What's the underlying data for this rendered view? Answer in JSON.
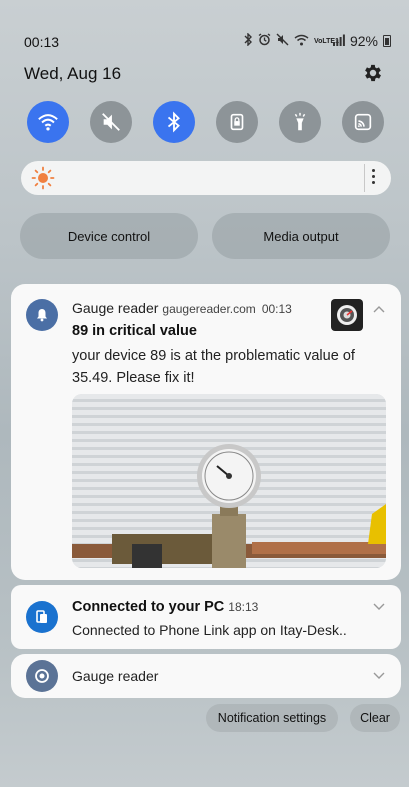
{
  "status_bar": {
    "time": "00:13",
    "network_label": "VoLTE1",
    "battery": "92%",
    "icons": [
      "bluetooth-icon",
      "alarm-icon",
      "mute-icon",
      "wifi-icon",
      "signal-icon",
      "battery-icon"
    ]
  },
  "header": {
    "date": "Wed, Aug 16"
  },
  "quick_toggles": [
    {
      "name": "wifi",
      "icon": "wifi-icon",
      "on": true
    },
    {
      "name": "sound",
      "icon": "mute-icon",
      "on": false
    },
    {
      "name": "bluetooth",
      "icon": "bluetooth-icon",
      "on": true
    },
    {
      "name": "rotation-lock",
      "icon": "lock-icon",
      "on": false
    },
    {
      "name": "flashlight",
      "icon": "flashlight-icon",
      "on": false
    },
    {
      "name": "cast",
      "icon": "cast-icon",
      "on": false
    }
  ],
  "colors": {
    "accent": "#3a74ef",
    "toggle_off": "#8d9498",
    "sun": "#f08040"
  },
  "controls": {
    "device_control": "Device control",
    "media_output": "Media output"
  },
  "notifications": [
    {
      "app": "Gauge reader",
      "source": "gaugereader.com",
      "time": "00:13",
      "title": "89 in critical value",
      "body": "your device 89 is at the problematic value of 35.49. Please fix it!"
    },
    {
      "app": "",
      "title": "Connected to your PC",
      "time": "18:13",
      "body": "Connected to Phone Link app on Itay-Desk.."
    },
    {
      "app": "Gauge reader"
    }
  ],
  "footer": {
    "notification_settings": "Notification settings",
    "clear": "Clear"
  }
}
